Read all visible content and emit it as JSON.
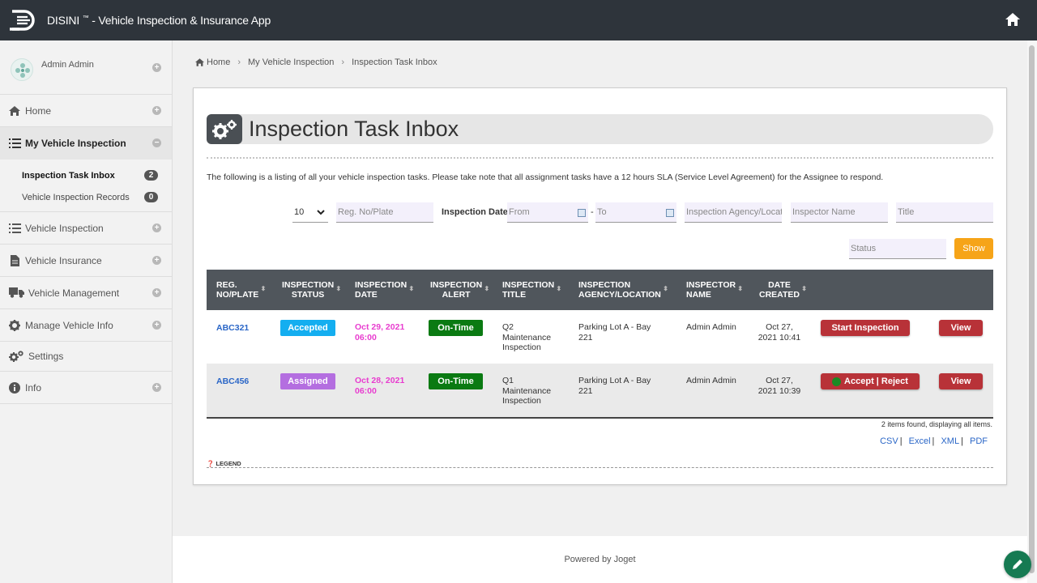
{
  "header": {
    "app_name": "DISINI",
    "trademark": "™",
    "app_subtitle": " - Vehicle Inspection & Insurance App"
  },
  "sidebar": {
    "user_name": "Admin Admin",
    "items": [
      {
        "label": "Home"
      },
      {
        "label": "My Vehicle Inspection"
      },
      {
        "label": "Vehicle Inspection"
      },
      {
        "label": "Vehicle Insurance"
      },
      {
        "label": "Vehicle Management"
      },
      {
        "label": "Manage Vehicle Info"
      },
      {
        "label": "Settings"
      },
      {
        "label": "Info"
      }
    ],
    "submenu": [
      {
        "label": "Inspection Task Inbox",
        "count": "2"
      },
      {
        "label": "Vehicle Inspection Records",
        "count": "0"
      }
    ]
  },
  "breadcrumb": [
    "Home",
    "My Vehicle Inspection",
    "Inspection Task Inbox"
  ],
  "page": {
    "title": "Inspection Task Inbox",
    "description": "The following is a listing of all your vehicle inspection tasks. Please take note that all assignment tasks have a 12 hours SLA (Service Level Agreement) for the Assignee to respond."
  },
  "filters": {
    "page_size": "10",
    "plate_placeholder": "Reg. No/Plate",
    "date_label": "Inspection Date",
    "from_placeholder": "From",
    "dash": "-",
    "to_placeholder": "To",
    "agency_placeholder": "Inspection Agency/Locati",
    "inspector_placeholder": "Inspector Name",
    "title_placeholder": "Title",
    "status_placeholder": "Status",
    "show_label": "Show"
  },
  "table": {
    "headers": [
      [
        "REG.",
        "NO/PLATE"
      ],
      [
        "INSPECTION",
        "STATUS"
      ],
      [
        "INSPECTION",
        "DATE"
      ],
      [
        "INSPECTION",
        "ALERT"
      ],
      [
        "INSPECTION",
        "TITLE"
      ],
      [
        "INSPECTION",
        "AGENCY/LOCATION"
      ],
      [
        "INSPECTOR",
        "NAME"
      ],
      [
        "DATE",
        "CREATED"
      ]
    ],
    "rows": [
      {
        "plate": "ABC321",
        "status": "Accepted",
        "date1": "Oct 29, 2021",
        "date2": "06:00",
        "alert": "On-Time",
        "title1": "Q2",
        "title2": "Maintenance",
        "title3": "Inspection",
        "loc1": "Parking Lot A - Bay",
        "loc2": "221",
        "inspector": "Admin Admin",
        "created1": "Oct 27,",
        "created2": "2021 10:41",
        "action": "Start Inspection",
        "view": "View"
      },
      {
        "plate": "ABC456",
        "status": "Assigned",
        "date1": "Oct 28, 2021",
        "date2": "06:00",
        "alert": "On-Time",
        "title1": "Q1",
        "title2": "Maintenance",
        "title3": "Inspection",
        "loc1": "Parking Lot A - Bay",
        "loc2": "221",
        "inspector": "Admin Admin",
        "created1": "Oct 27,",
        "created2": "2021 10:39",
        "action": "Accept | Reject",
        "view": "View"
      }
    ],
    "count_text": "2 items found, displaying all items.",
    "exports": [
      "CSV",
      "Excel",
      "XML",
      "PDF"
    ],
    "legend": "LEGEND"
  },
  "footer": {
    "text": "Powered by Joget"
  },
  "colors": {
    "topbar": "#2e343b",
    "accepted": "#14aef0",
    "assigned": "#b46ee0",
    "ontime": "#0a7a12",
    "danger": "#b83238",
    "show": "#f6a418"
  }
}
